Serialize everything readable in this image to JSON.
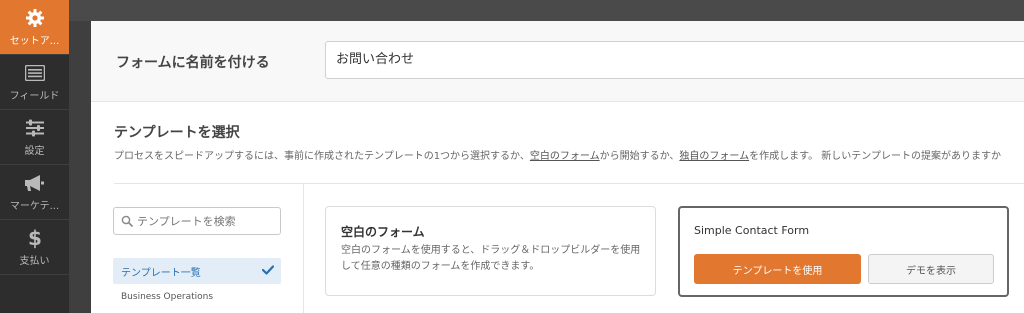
{
  "sidebar": {
    "items": [
      {
        "label": "セットア...",
        "icon": "gear-icon",
        "active": true
      },
      {
        "label": "フィールド",
        "icon": "fields-list-icon",
        "active": false
      },
      {
        "label": "設定",
        "icon": "sliders-icon",
        "active": false
      },
      {
        "label": "マーケテ...",
        "icon": "megaphone-icon",
        "active": false
      },
      {
        "label": "支払い",
        "icon": "dollar-icon",
        "active": false
      }
    ]
  },
  "form_name": {
    "label": "フォームに名前を付ける",
    "value": "お問い合わせ"
  },
  "template_select": {
    "title": "テンプレートを選択",
    "description_part1": "プロセスをスピードアップするには、事前に作成されたテンプレートの1つから選択するか、",
    "link_blank": "空白のフォーム",
    "description_part2": "から開始するか、",
    "link_custom": "独自のフォーム",
    "description_part3": "を作成します。 新しいテンプレートの提案がありますか"
  },
  "search": {
    "placeholder": "テンプレートを検索"
  },
  "categories": {
    "active": "テンプレート一覧",
    "items": [
      "Business Operations"
    ]
  },
  "cards": {
    "blank": {
      "title": "空白のフォーム",
      "description": "空白のフォームを使用すると、ドラッグ＆ドロップビルダーを使用して任意の種類のフォームを作成できます。"
    },
    "simple": {
      "title": "Simple Contact Form",
      "use_button": "テンプレートを使用",
      "demo_button": "デモを表示"
    }
  },
  "colors": {
    "accent": "#e27730",
    "sidebar_bg": "#2d2d2d",
    "active_category_bg": "#e3edf7",
    "active_category_text": "#2a6fb0"
  }
}
